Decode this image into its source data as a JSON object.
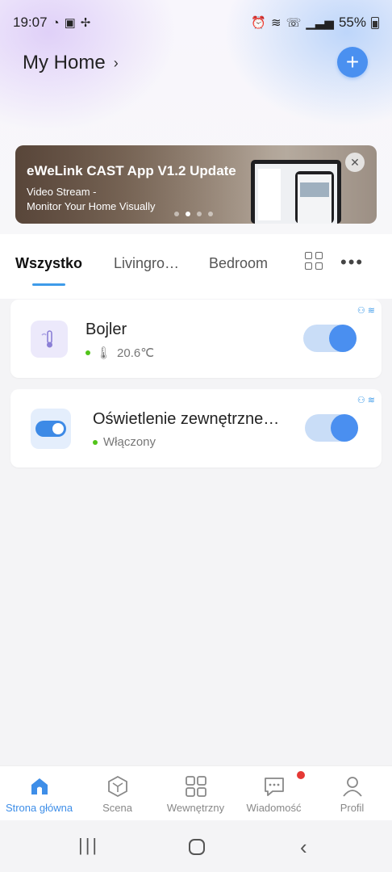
{
  "status_bar": {
    "time": "19:07",
    "left_icons": [
      "whatsapp-icon",
      "gallery-icon",
      "fan-icon"
    ],
    "right_icons": [
      "alarm-icon",
      "wifi-icon",
      "wifi-call-icon",
      "signal-icon"
    ],
    "battery": "55%"
  },
  "header": {
    "title": "My Home",
    "add_label": "+"
  },
  "banner": {
    "title": "eWeLink CAST App V1.2 Update",
    "subtitle_line1": "Video Stream -",
    "subtitle_line2": "Monitor Your Home Visually",
    "close_label": "✕",
    "pages": 4,
    "active_page": 2
  },
  "tabs": [
    {
      "label": "Wszystko",
      "active": true
    },
    {
      "label": "Livingro…",
      "active": false
    },
    {
      "label": "Bedroom",
      "active": false
    }
  ],
  "devices": [
    {
      "name": "Bojler",
      "status": "20.6℃",
      "on": true,
      "icon": "thermometer-icon"
    },
    {
      "name": "Oświetlenie zewnętrzne…",
      "status": "Włączony",
      "on": true,
      "icon": "switch-icon"
    }
  ],
  "bottom_nav": [
    {
      "label": "Strona główna",
      "icon": "home-icon",
      "active": true
    },
    {
      "label": "Scena",
      "icon": "scene-icon",
      "active": false
    },
    {
      "label": "Wewnętrzny",
      "icon": "grid-icon",
      "active": false
    },
    {
      "label": "Wiadomość",
      "icon": "message-icon",
      "active": false
    },
    {
      "label": "Profil",
      "icon": "profile-icon",
      "active": false
    }
  ],
  "colors": {
    "accent": "#4a8ff0",
    "online": "#52c41a",
    "notification": "#e53935"
  }
}
